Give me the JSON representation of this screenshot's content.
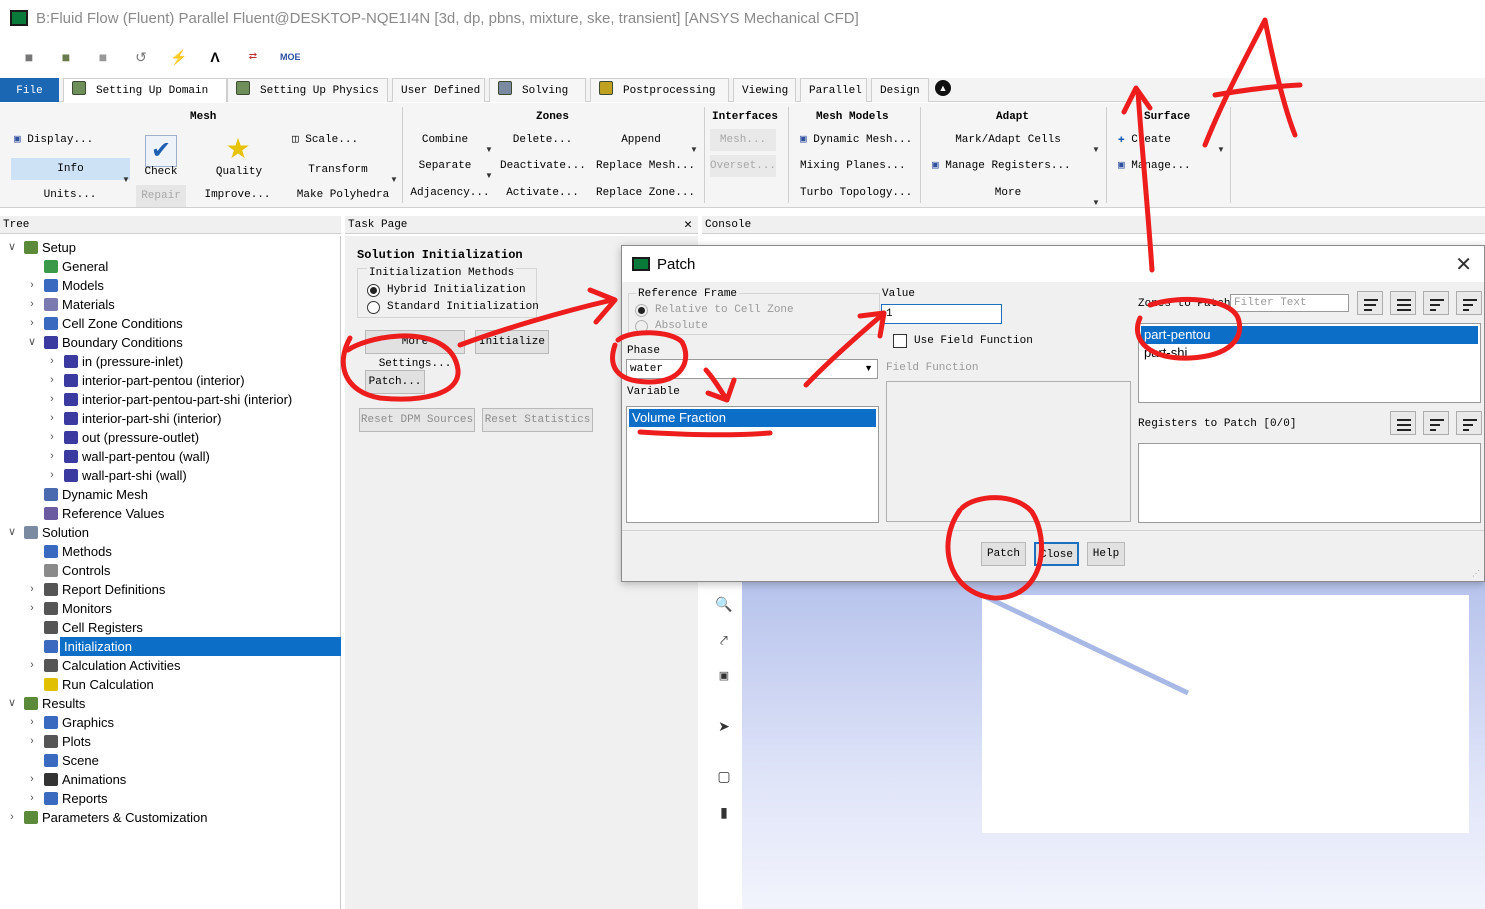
{
  "window": {
    "title": "B:Fluid Flow (Fluent) Parallel Fluent@DESKTOP-NQE1I4N  [3d, dp, pbns, mixture, ske, transient] [ANSYS Mechanical CFD]"
  },
  "ribbon_tabs": {
    "file": "File",
    "setting_up_domain": "Setting Up Domain",
    "setting_up_physics": "Setting Up Physics",
    "user_defined": "User Defined",
    "solving": "Solving",
    "postprocessing": "Postprocessing",
    "viewing": "Viewing",
    "parallel": "Parallel",
    "design": "Design"
  },
  "ribbon": {
    "mesh": {
      "title": "Mesh",
      "display": "Display...",
      "info": "Info",
      "units": "Units...",
      "check": "Check",
      "repair": "Repair",
      "quality": "Quality",
      "improve": "Improve...",
      "scale": "Scale...",
      "transform": "Transform",
      "make_polyhedra": "Make Polyhedra"
    },
    "zones": {
      "title": "Zones",
      "combine": "Combine",
      "separate": "Separate",
      "adjacency": "Adjacency...",
      "delete": "Delete...",
      "deactivate": "Deactivate...",
      "activate": "Activate...",
      "append": "Append",
      "replace_mesh": "Replace Mesh...",
      "replace_zone": "Replace Zone..."
    },
    "interfaces": {
      "title": "Interfaces",
      "mesh": "Mesh...",
      "overset": "Overset..."
    },
    "mesh_models": {
      "title": "Mesh Models",
      "dynamic_mesh": "Dynamic Mesh...",
      "mixing_planes": "Mixing Planes...",
      "turbo_topology": "Turbo Topology..."
    },
    "adapt": {
      "title": "Adapt",
      "mark_adapt": "Mark/Adapt Cells",
      "manage_registers": "Manage Registers...",
      "more": "More"
    },
    "surface": {
      "title": "Surface",
      "create": "Create",
      "manage": "Manage..."
    }
  },
  "panels": {
    "tree": "Tree",
    "task_page": "Task Page",
    "console": "Console"
  },
  "tree": {
    "items": [
      {
        "label": "Setup",
        "depth": 0,
        "arrow": "open",
        "icon": "setup-icon",
        "color": "#5a8a3a"
      },
      {
        "label": "General",
        "depth": 1,
        "arrow": "",
        "icon": "general-icon",
        "color": "#3a9a4a"
      },
      {
        "label": "Models",
        "depth": 1,
        "arrow": "closed",
        "icon": "models-icon",
        "color": "#3a6ac0"
      },
      {
        "label": "Materials",
        "depth": 1,
        "arrow": "closed",
        "icon": "materials-icon",
        "color": "#7a7ab0"
      },
      {
        "label": "Cell Zone Conditions",
        "depth": 1,
        "arrow": "closed",
        "icon": "cell-zone-icon",
        "color": "#3a6ac0"
      },
      {
        "label": "Boundary Conditions",
        "depth": 1,
        "arrow": "open",
        "icon": "boundary-icon",
        "color": "#3a3aa0"
      },
      {
        "label": "in (pressure-inlet)",
        "depth": 2,
        "arrow": "closed",
        "icon": "boundary-icon",
        "color": "#3a3aa0"
      },
      {
        "label": "interior-part-pentou (interior)",
        "depth": 2,
        "arrow": "closed",
        "icon": "boundary-icon",
        "color": "#3a3aa0"
      },
      {
        "label": "interior-part-pentou-part-shi (interior)",
        "depth": 2,
        "arrow": "closed",
        "icon": "boundary-icon",
        "color": "#3a3aa0"
      },
      {
        "label": "interior-part-shi (interior)",
        "depth": 2,
        "arrow": "closed",
        "icon": "boundary-icon",
        "color": "#3a3aa0"
      },
      {
        "label": "out (pressure-outlet)",
        "depth": 2,
        "arrow": "closed",
        "icon": "boundary-icon",
        "color": "#3a3aa0"
      },
      {
        "label": "wall-part-pentou (wall)",
        "depth": 2,
        "arrow": "closed",
        "icon": "boundary-icon",
        "color": "#3a3aa0"
      },
      {
        "label": "wall-part-shi (wall)",
        "depth": 2,
        "arrow": "closed",
        "icon": "boundary-icon",
        "color": "#3a3aa0"
      },
      {
        "label": "Dynamic Mesh",
        "depth": 1,
        "arrow": "",
        "icon": "dynamic-mesh-icon",
        "color": "#4a6ab0"
      },
      {
        "label": "Reference Values",
        "depth": 1,
        "arrow": "",
        "icon": "reference-values-icon",
        "color": "#6a5aa0"
      },
      {
        "label": "Solution",
        "depth": 0,
        "arrow": "open",
        "icon": "solution-icon",
        "color": "#7a8aa0"
      },
      {
        "label": "Methods",
        "depth": 1,
        "arrow": "",
        "icon": "methods-icon",
        "color": "#3a6ac0"
      },
      {
        "label": "Controls",
        "depth": 1,
        "arrow": "",
        "icon": "controls-icon",
        "color": "#8a8a8a"
      },
      {
        "label": "Report Definitions",
        "depth": 1,
        "arrow": "closed",
        "icon": "report-definitions-icon",
        "color": "#555555"
      },
      {
        "label": "Monitors",
        "depth": 1,
        "arrow": "closed",
        "icon": "monitors-icon",
        "color": "#555555"
      },
      {
        "label": "Cell Registers",
        "depth": 1,
        "arrow": "",
        "icon": "cell-registers-icon",
        "color": "#555555"
      },
      {
        "label": "Initialization",
        "depth": 1,
        "arrow": "",
        "icon": "initialization-icon",
        "color": "#3a6ac0",
        "selected": true
      },
      {
        "label": "Calculation Activities",
        "depth": 1,
        "arrow": "closed",
        "icon": "calculation-activities-icon",
        "color": "#555555"
      },
      {
        "label": "Run Calculation",
        "depth": 1,
        "arrow": "",
        "icon": "run-calculation-icon",
        "color": "#e0c000"
      },
      {
        "label": "Results",
        "depth": 0,
        "arrow": "open",
        "icon": "results-icon",
        "color": "#5a8a3a"
      },
      {
        "label": "Graphics",
        "depth": 1,
        "arrow": "closed",
        "icon": "graphics-icon",
        "color": "#3a6ac0"
      },
      {
        "label": "Plots",
        "depth": 1,
        "arrow": "closed",
        "icon": "plots-icon",
        "color": "#555555"
      },
      {
        "label": "Scene",
        "depth": 1,
        "arrow": "",
        "icon": "scene-icon",
        "color": "#3a6ac0"
      },
      {
        "label": "Animations",
        "depth": 1,
        "arrow": "closed",
        "icon": "animations-icon",
        "color": "#333333"
      },
      {
        "label": "Reports",
        "depth": 1,
        "arrow": "closed",
        "icon": "reports-icon",
        "color": "#3a6ac0"
      },
      {
        "label": "Parameters & Customization",
        "depth": 0,
        "arrow": "closed",
        "icon": "parameters-icon",
        "color": "#5a8a3a"
      }
    ]
  },
  "task": {
    "title": "Solution Initialization",
    "methods_label": "Initialization Methods",
    "hybrid": "Hybrid  Initialization",
    "standard": "Standard Initialization",
    "more_settings": "More Settings...",
    "initialize": "Initialize",
    "patch": "Patch...",
    "reset_dpm": "Reset DPM Sources",
    "reset_stats": "Reset Statistics"
  },
  "dialog": {
    "title": "Patch",
    "reference_frame": "Reference Frame",
    "relative": "Relative to Cell Zone",
    "absolute": "Absolute",
    "phase_label": "Phase",
    "phase_value": "water",
    "variable_label": "Variable",
    "variable_items": [
      "Volume Fraction"
    ],
    "value_label": "Value",
    "value": "1",
    "use_field_function": "Use Field Function",
    "field_function": "Field Function",
    "zones_label": "Zones to Patch",
    "filter_placeholder": "Filter Text",
    "zones": [
      {
        "label": "part-pentou",
        "selected": true
      },
      {
        "label": "part-shi",
        "selected": false
      }
    ],
    "registers_label": "Registers to Patch [0/0]",
    "patch_btn": "Patch",
    "close_btn": "Close",
    "help_btn": "Help"
  },
  "annotations": {
    "letter": "A",
    "color": "#ee1d1d"
  }
}
